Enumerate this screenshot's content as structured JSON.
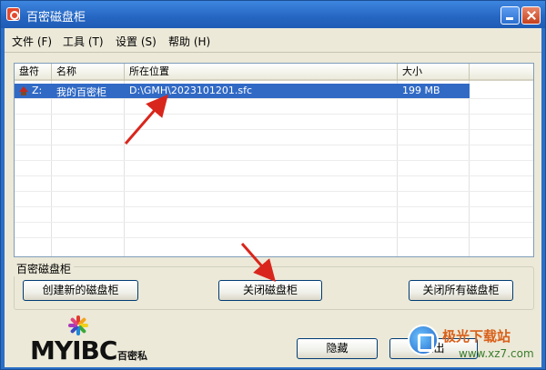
{
  "window": {
    "title": "百密磁盘柜"
  },
  "menu": {
    "file": "文件 (F)",
    "tools": "工具 (T)",
    "settings": "设置 (S)",
    "help": "帮助 (H)"
  },
  "list": {
    "columns": [
      "盘符",
      "名称",
      "所在位置",
      "大小"
    ],
    "rows": [
      {
        "drive": "Z:",
        "name": "我的百密柜",
        "location": "D:\\GMH\\2023101201.sfc",
        "size": "199 MB",
        "selected": true
      }
    ]
  },
  "group": {
    "title": "百密磁盘柜",
    "create_label": "创建新的磁盘柜",
    "close_label": "关闭磁盘柜",
    "close_all_label": "关闭所有磁盘柜"
  },
  "footer": {
    "hide_label": "隐藏",
    "exit_label": "退出"
  },
  "logo": {
    "text": "MYIBC",
    "sub": "百密私"
  },
  "watermark": {
    "title": "极光下载站",
    "url": "www.xz7.com"
  },
  "colors": {
    "title_bar": "#2566c2",
    "selection": "#316ac5",
    "annotation_arrow": "#d9261c",
    "window_bg": "#ece9d8"
  },
  "icons": [
    "app-icon",
    "minimize-icon",
    "close-icon",
    "drive-icon",
    "logo-burst-icon",
    "watermark-icon"
  ]
}
